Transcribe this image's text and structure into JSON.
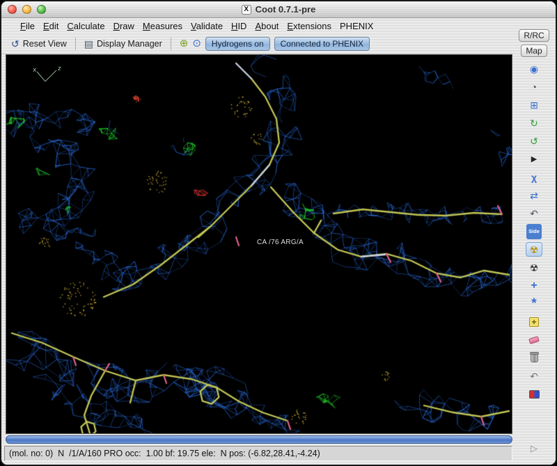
{
  "window": {
    "title": "Coot 0.7.1-pre",
    "title_icon": "X"
  },
  "menu": {
    "items": [
      "File",
      "Edit",
      "Calculate",
      "Draw",
      "Measures",
      "Validate",
      "HID",
      "About",
      "Extensions",
      "PHENIX"
    ]
  },
  "toolbar": {
    "reset_view_label": "Reset View",
    "display_manager_label": "Display Manager",
    "hydrogens_button": "Hydrogens on",
    "phenix_button": "Connected to PHENIX"
  },
  "right_panel": {
    "rrc_button": "R/RC",
    "map_button": "Map",
    "icons": [
      {
        "name": "sphere-refine-icon",
        "glyph": "◉"
      },
      {
        "name": "spin-view-icon",
        "glyph": "◔"
      },
      {
        "name": "rigid-body-fit-icon",
        "glyph": "⊞"
      },
      {
        "name": "rotate-zone-icon",
        "glyph": "↻"
      },
      {
        "name": "auto-fit-rotamer-icon",
        "glyph": "↺"
      },
      {
        "name": "rotamers-icon",
        "glyph": "▶"
      },
      {
        "name": "edit-chi-angles-icon",
        "glyph": "χ"
      },
      {
        "name": "torsion-general-icon",
        "glyph": "⇄"
      },
      {
        "name": "flip-peptide-icon",
        "glyph": "↶"
      },
      {
        "name": "side-chain-flip-icon",
        "glyph": "Side"
      },
      {
        "name": "mutate-autofit-icon",
        "glyph": "☢"
      },
      {
        "name": "simple-mutate-icon",
        "glyph": "☢"
      },
      {
        "name": "add-alt-conf-icon",
        "glyph": "+"
      },
      {
        "name": "place-atom-icon",
        "glyph": "*"
      },
      {
        "name": "add-terminal-residue-icon",
        "glyph": "+"
      },
      {
        "name": "eraser-icon",
        "glyph": ""
      },
      {
        "name": "delete-item-icon",
        "glyph": ""
      },
      {
        "name": "undo-icon",
        "glyph": "↶"
      },
      {
        "name": "color-map-icon",
        "glyph": ""
      }
    ]
  },
  "canvas": {
    "atom_label": "CA /76 ARG/A",
    "axis_labels": {
      "x": "x",
      "z": "z"
    }
  },
  "statusbar": {
    "text": "(mol. no: 0)  N  /1/A/160 PRO occ:  1.00 bf: 19.75 ele:  N pos: (-6.82,28.41,-4.24)"
  },
  "colors": {
    "mesh_blue": "#2b6fe2",
    "diff_green": "#23d92e",
    "diff_red": "#e03434",
    "model_yellow": "#c3c754",
    "model_pale": "#c7d2e2",
    "tick_pink": "#e2638c",
    "dots_gold": "#b89a30"
  }
}
